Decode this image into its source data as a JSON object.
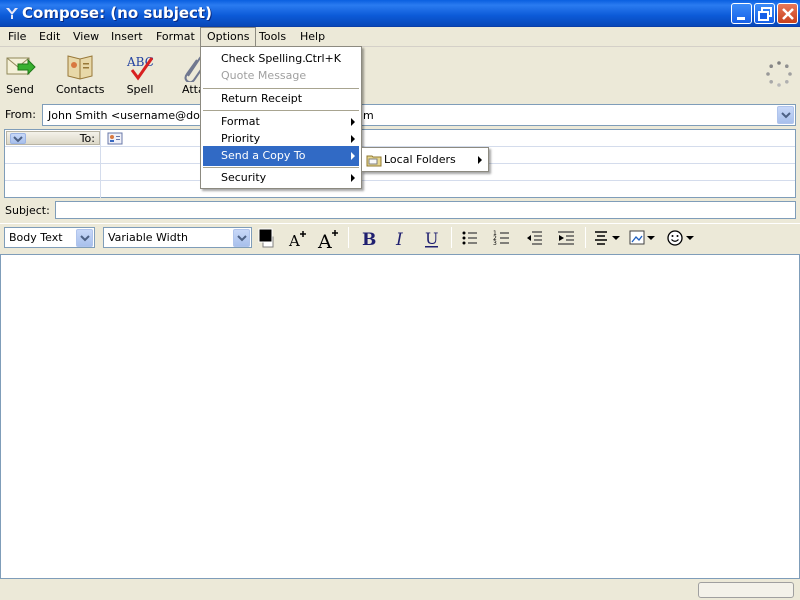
{
  "window": {
    "title": "Compose: (no subject)",
    "title_color": "#0c5ad8"
  },
  "menubar": {
    "items": [
      "File",
      "Edit",
      "View",
      "Insert",
      "Format",
      "Options",
      "Tools",
      "Help"
    ],
    "active": "Options"
  },
  "toolbar": {
    "send": "Send",
    "contacts": "Contacts",
    "spell": "Spell",
    "attach": "Atta"
  },
  "header": {
    "from_label": "From:",
    "from_value": "John Smith <username@domai",
    "from_value_tail": "m",
    "to_label": "To:",
    "subject_label": "Subject:",
    "subject_value": ""
  },
  "format": {
    "paragraph_style": "Body Text",
    "font": "Variable Width",
    "text_color": "#000000"
  },
  "options_menu": {
    "items": [
      {
        "label": "Check Spelling...",
        "shortcut": "Ctrl+K",
        "disabled": false
      },
      {
        "label": "Quote Message",
        "disabled": true
      },
      {
        "label": "Return Receipt"
      },
      {
        "label": "Format",
        "submenu": true
      },
      {
        "label": "Priority",
        "submenu": true
      },
      {
        "label": "Send a Copy To",
        "submenu": true,
        "highlighted": true
      },
      {
        "label": "Security",
        "submenu": true
      }
    ]
  },
  "send_copy_submenu": {
    "items": [
      {
        "label": "Local Folders",
        "submenu": true
      }
    ]
  },
  "colors": {
    "highlight": "#316ac5",
    "window_bg": "#ece9d8"
  }
}
